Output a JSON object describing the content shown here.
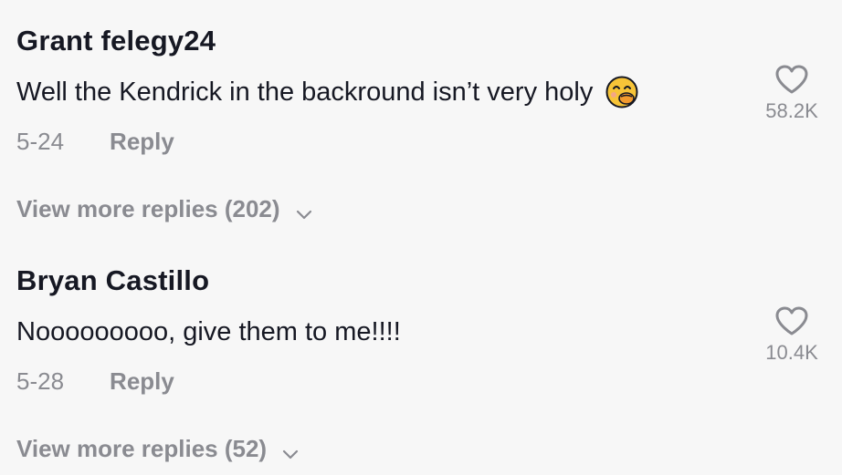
{
  "comments": [
    {
      "username": "Grant felegy24",
      "text": "Well the Kendrick in the backround isn’t very holy",
      "emoji": "face-with-hand-over-mouth",
      "date": "5-24",
      "reply_label": "Reply",
      "likes": "58.2K",
      "view_more": "View more replies (202)"
    },
    {
      "username": "Bryan Castillo",
      "text": "Nooooooooo, give them to me!!!!",
      "date": "5-28",
      "reply_label": "Reply",
      "likes": "10.4K",
      "view_more": "View more replies (52)"
    }
  ],
  "colors": {
    "background": "#f7f7f7",
    "primary_text": "#161823",
    "secondary_text": "#8a8b91",
    "emoji_face": "#f7c438"
  }
}
